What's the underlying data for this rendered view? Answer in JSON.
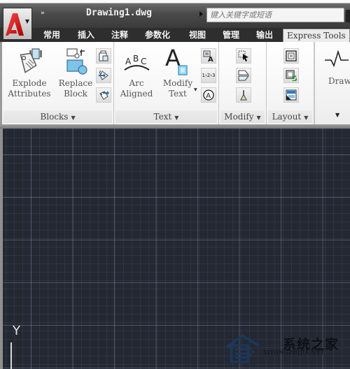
{
  "app": {
    "logo_icon": "autocad-logo-icon",
    "document_title": "Drawing1.dwg",
    "quick_access_overflow": "»",
    "search": {
      "placeholder": "键入关键字或短语",
      "value": ""
    }
  },
  "tabs": [
    {
      "label": "常用",
      "active": false
    },
    {
      "label": "插入",
      "active": false
    },
    {
      "label": "注释",
      "active": false
    },
    {
      "label": "参数化",
      "active": false
    },
    {
      "label": "视图",
      "active": false
    },
    {
      "label": "管理",
      "active": false
    },
    {
      "label": "输出",
      "active": false
    },
    {
      "label": "Express Tools",
      "active": true
    }
  ],
  "ribbon": {
    "panels": {
      "blocks": {
        "title": "Blocks",
        "buttons": [
          {
            "line1": "Explode",
            "line2": "Attributes",
            "icon": "explode-attributes-icon"
          },
          {
            "line1": "Replace",
            "line2": "Block",
            "icon": "replace-block-icon"
          }
        ],
        "small_buttons": [
          "copy-nested-icon",
          "block-export-icon",
          "block-import-icon"
        ]
      },
      "text": {
        "title": "Text",
        "buttons": [
          {
            "line1": "Arc",
            "line2": "Aligned",
            "icon": "arc-aligned-text-icon",
            "glyph": "ABC"
          },
          {
            "line1": "Modify",
            "line2": "Text",
            "icon": "modify-text-icon",
            "glyph": "A"
          }
        ],
        "small_buttons": [
          "remote-text-icon",
          "auto-number-icon",
          "enclose-text-icon"
        ],
        "auto_number_glyph": "1›2›3",
        "enclose_glyph": "A"
      },
      "modify": {
        "title": "Modify",
        "small_buttons": [
          "move-copy-rotate-icon",
          "stretch-multiple-icon",
          "break-line-icon"
        ]
      },
      "layout": {
        "title": "Layout",
        "small_buttons": [
          "align-space-icon",
          "synchronize-viewports-icon",
          "list-viewport-scale-icon"
        ]
      },
      "draw": {
        "label": "Draw",
        "icon": "draw-breakline-icon"
      }
    },
    "dropdown_caret": "▼"
  },
  "canvas": {
    "background": "#232833",
    "ucs_axis_label": "Y"
  },
  "watermark": {
    "text": "系统之家",
    "url": "XITONGZHIJIA.NET"
  }
}
